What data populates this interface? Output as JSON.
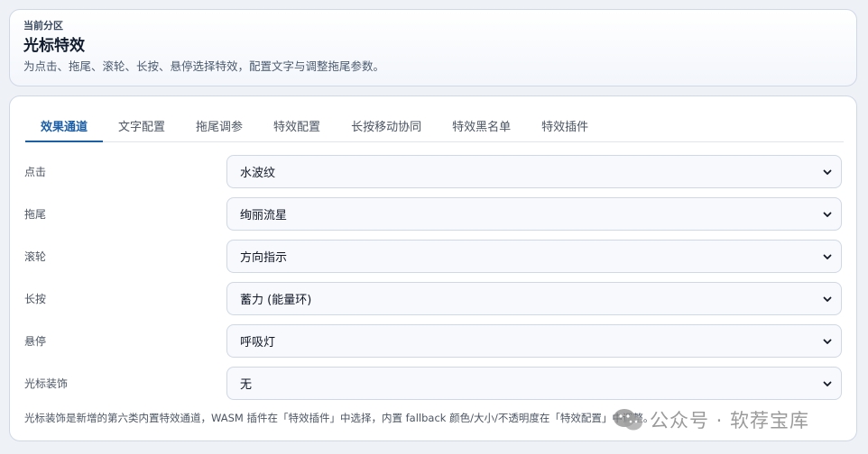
{
  "header": {
    "crumb": "当前分区",
    "title": "光标特效",
    "description": "为点击、拖尾、滚轮、长按、悬停选择特效，配置文字与调整拖尾参数。"
  },
  "tabs": [
    {
      "label": "效果通道",
      "active": true
    },
    {
      "label": "文字配置",
      "active": false
    },
    {
      "label": "拖尾调参",
      "active": false
    },
    {
      "label": "特效配置",
      "active": false
    },
    {
      "label": "长按移动协同",
      "active": false
    },
    {
      "label": "特效黑名单",
      "active": false
    },
    {
      "label": "特效插件",
      "active": false
    }
  ],
  "rows": [
    {
      "label": "点击",
      "value": "水波纹"
    },
    {
      "label": "拖尾",
      "value": "绚丽流星"
    },
    {
      "label": "滚轮",
      "value": "方向指示"
    },
    {
      "label": "长按",
      "value": "蓄力 (能量环)"
    },
    {
      "label": "悬停",
      "value": "呼吸灯"
    },
    {
      "label": "光标装饰",
      "value": "无"
    }
  ],
  "footnote": "光标装饰是新增的第六类内置特效通道，WASM 插件在「特效插件」中选择，内置 fallback 颜色/大小/不透明度在「特效配置」中调整。",
  "watermark": {
    "text": "公众号 · 软荐宝库"
  },
  "colors": {
    "accent": "#1d5fa6",
    "border": "#cfd8e6",
    "background": "#eef1f5"
  }
}
